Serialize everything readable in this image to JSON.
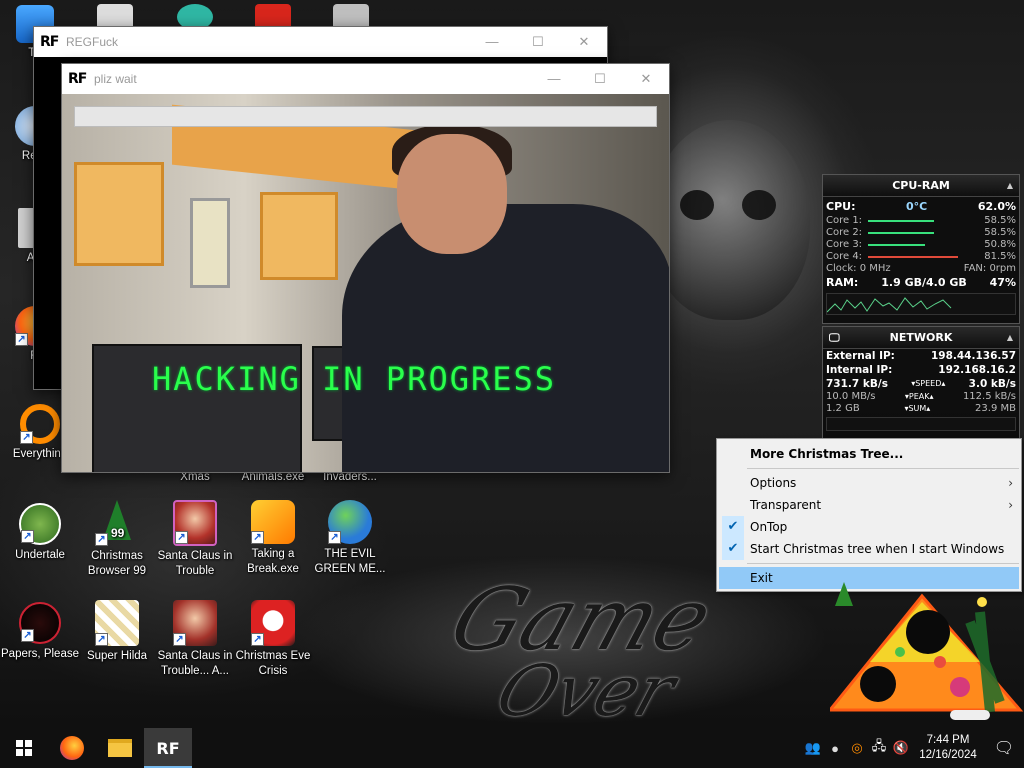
{
  "windows": {
    "regfuck": {
      "title": "REGFuck",
      "icon_text": "RF"
    },
    "pliz_wait": {
      "title": "pliz wait",
      "icon_text": "RF",
      "progress": 0.0,
      "video_overlay_text": "HACKING IN PROGRESS"
    },
    "controls": {
      "minimize": "—",
      "maximize": "☐",
      "close": "✕"
    }
  },
  "desktop_icons": [
    {
      "label": "Th",
      "icon": "this-pc-icon"
    },
    {
      "label": "Recy",
      "icon": "recycle-bin-icon"
    },
    {
      "label": "Act",
      "icon": "activator-icon"
    },
    {
      "label": "Fi",
      "icon": "firefox-icon"
    },
    {
      "label": "Everything",
      "icon": "everything-search-icon"
    },
    {
      "label": "Xmas",
      "icon": "xmas-icon"
    },
    {
      "label": "Animals.exe",
      "icon": "animals-exe-icon"
    },
    {
      "label": "Invaders...",
      "icon": "invaders-icon"
    },
    {
      "label": "Undertale",
      "icon": "undertale-icon"
    },
    {
      "label": "Christmas Browser 99",
      "icon": "christmas-browser-icon"
    },
    {
      "label": "Santa Claus in Trouble",
      "icon": "santa-claus-icon"
    },
    {
      "label": "Taking a Break.exe",
      "icon": "taking-a-break-icon"
    },
    {
      "label": "THE EVIL GREEN ME...",
      "icon": "evil-green-icon"
    },
    {
      "label": "Papers, Please",
      "icon": "papers-please-icon"
    },
    {
      "label": "Super Hilda",
      "icon": "super-hilda-icon"
    },
    {
      "label": "Santa Claus in Trouble... A...",
      "icon": "santa-claus-2-icon"
    },
    {
      "label": "Christmas Eve Crisis",
      "icon": "christmas-eve-crisis-icon"
    }
  ],
  "cpu_gadget": {
    "title": "CPU-RAM",
    "cpu_label": "CPU:",
    "temp": "0°C",
    "cpu_value": "62.0%",
    "cores": [
      {
        "label": "Core 1:",
        "value": "58.5%"
      },
      {
        "label": "Core 2:",
        "value": "58.5%"
      },
      {
        "label": "Core 3:",
        "value": "50.8%"
      },
      {
        "label": "Core 4:",
        "value": "81.5%"
      }
    ],
    "clock": "Clock: 0 MHz",
    "fan": "FAN: 0rpm",
    "ram_label": "RAM:",
    "ram_value": "1.9 GB/4.0 GB",
    "ram_percent": "47%"
  },
  "net_gadget": {
    "title": "NETWORK",
    "external_ip_label": "External IP:",
    "external_ip": "198.44.136.57",
    "internal_ip_label": "Internal IP:",
    "internal_ip": "192.168.16.2",
    "speed_down": "731.7 kB/s",
    "speed_label": "SPEED",
    "speed_up": "3.0 kB/s",
    "peak_down": "10.0 MB/s",
    "peak_label": "PEAK",
    "peak_up": "112.5 kB/s",
    "sum_down": "1.2 GB",
    "sum_label": "SUM",
    "sum_up": "23.9 MB"
  },
  "context_menu": {
    "more": "More Christmas Tree...",
    "options": "Options",
    "transparent": "Transparent",
    "ontop": "OnTop",
    "startup": "Start Christmas tree when I start Windows",
    "exit": "Exit"
  },
  "wallpaper": {
    "line1": "Game",
    "line2": "Over"
  },
  "taskbar": {
    "time": "7:44 PM",
    "date": "12/16/2024",
    "active_app": "RF"
  }
}
